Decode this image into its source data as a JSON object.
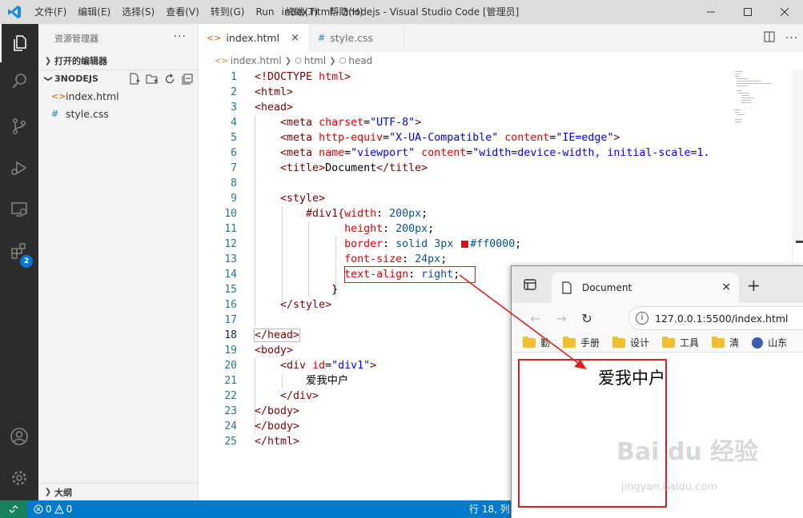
{
  "titlebar": {
    "menu": [
      "文件(F)",
      "编辑(E)",
      "选择(S)",
      "查看(V)",
      "转到(G)",
      "Run",
      "终端(T)",
      "帮助(H)"
    ],
    "title": "index.html - 3nodejs - Visual Studio Code [管理员]"
  },
  "activity": {
    "extensions_badge": "2"
  },
  "sidebar": {
    "header": "资源管理器",
    "more": "···",
    "open_editors": "打开的编辑器",
    "project": "3NODEJS",
    "files": [
      {
        "icon": "<>",
        "name": "index.html"
      },
      {
        "icon": "#",
        "name": "style.css"
      }
    ],
    "outline": "大纲"
  },
  "editor": {
    "tabs": [
      {
        "icon": "<>",
        "label": "index.html",
        "close": "×"
      },
      {
        "icon": "#",
        "label": "style.css"
      }
    ],
    "breadcrumb": [
      "index.html",
      "html",
      "head"
    ],
    "line_numbers": [
      "1",
      "2",
      "3",
      "4",
      "5",
      "6",
      "7",
      "8",
      "9",
      "10",
      "11",
      "12",
      "13",
      "14",
      "15",
      "16",
      "17",
      "18",
      "19",
      "20",
      "21",
      "22",
      "23",
      "24",
      "25"
    ],
    "code": {
      "l1_kw": "<!DOCTYPE",
      "l1_v": "html",
      "l1_end": ">",
      "l2": "<html>",
      "l3": "<head>",
      "l4_open": "<meta",
      "l4_attr": "charset",
      "l4_val": "\"UTF-8\"",
      "l4_close": ">",
      "l5_open": "<meta",
      "l5_a1": "http-equiv",
      "l5_v1": "\"X-UA-Compatible\"",
      "l5_a2": "content",
      "l5_v2": "\"IE=edge\"",
      "l5_close": ">",
      "l6_open": "<meta",
      "l6_a1": "name",
      "l6_v1": "\"viewport\"",
      "l6_a2": "content",
      "l6_v2": "\"width=device-width, initial-scale=1.",
      "l7_open": "<title>",
      "l7_text": "Document",
      "l7_close": "</title>",
      "l9": "<style>",
      "l10_sel": "#div1{",
      "l10_prop": "width",
      "l10_val": "200px",
      "l11_prop": "height",
      "l11_val": "200px",
      "l12_prop": "border",
      "l12_val1": "solid",
      "l12_val2": "3px",
      "l12_color": "#ff0000",
      "l13_prop": "font-size",
      "l13_val": "24px",
      "l14_prop": "text-align",
      "l14_val": "right",
      "l15": "}",
      "l16": "</style>",
      "l18": "</head>",
      "l19": "<body>",
      "l20_open": "<div",
      "l20_attr": "id",
      "l20_val": "\"div1\"",
      "l20_close": ">",
      "l21": "爱我中户",
      "l22": "</div>",
      "l23": "</body>",
      "l24": "</body>",
      "l25": "</html>"
    }
  },
  "statusbar": {
    "errors": "0",
    "warnings": "0",
    "position": "行 18, 列"
  },
  "browser": {
    "tab_title": "Document",
    "tab_close": "×",
    "new_tab": "+",
    "url": "127.0.0.1:5500/index.html",
    "bookmarks": [
      "勤",
      "手册",
      "设计",
      "工具",
      "清",
      "山东"
    ],
    "content_text": "爱我中户"
  },
  "watermark": {
    "logo": "Bai  du 经验",
    "sub": "jingyan.baidu.com"
  },
  "colors": {
    "accent": "#007acc",
    "highlight": "#d92020"
  }
}
